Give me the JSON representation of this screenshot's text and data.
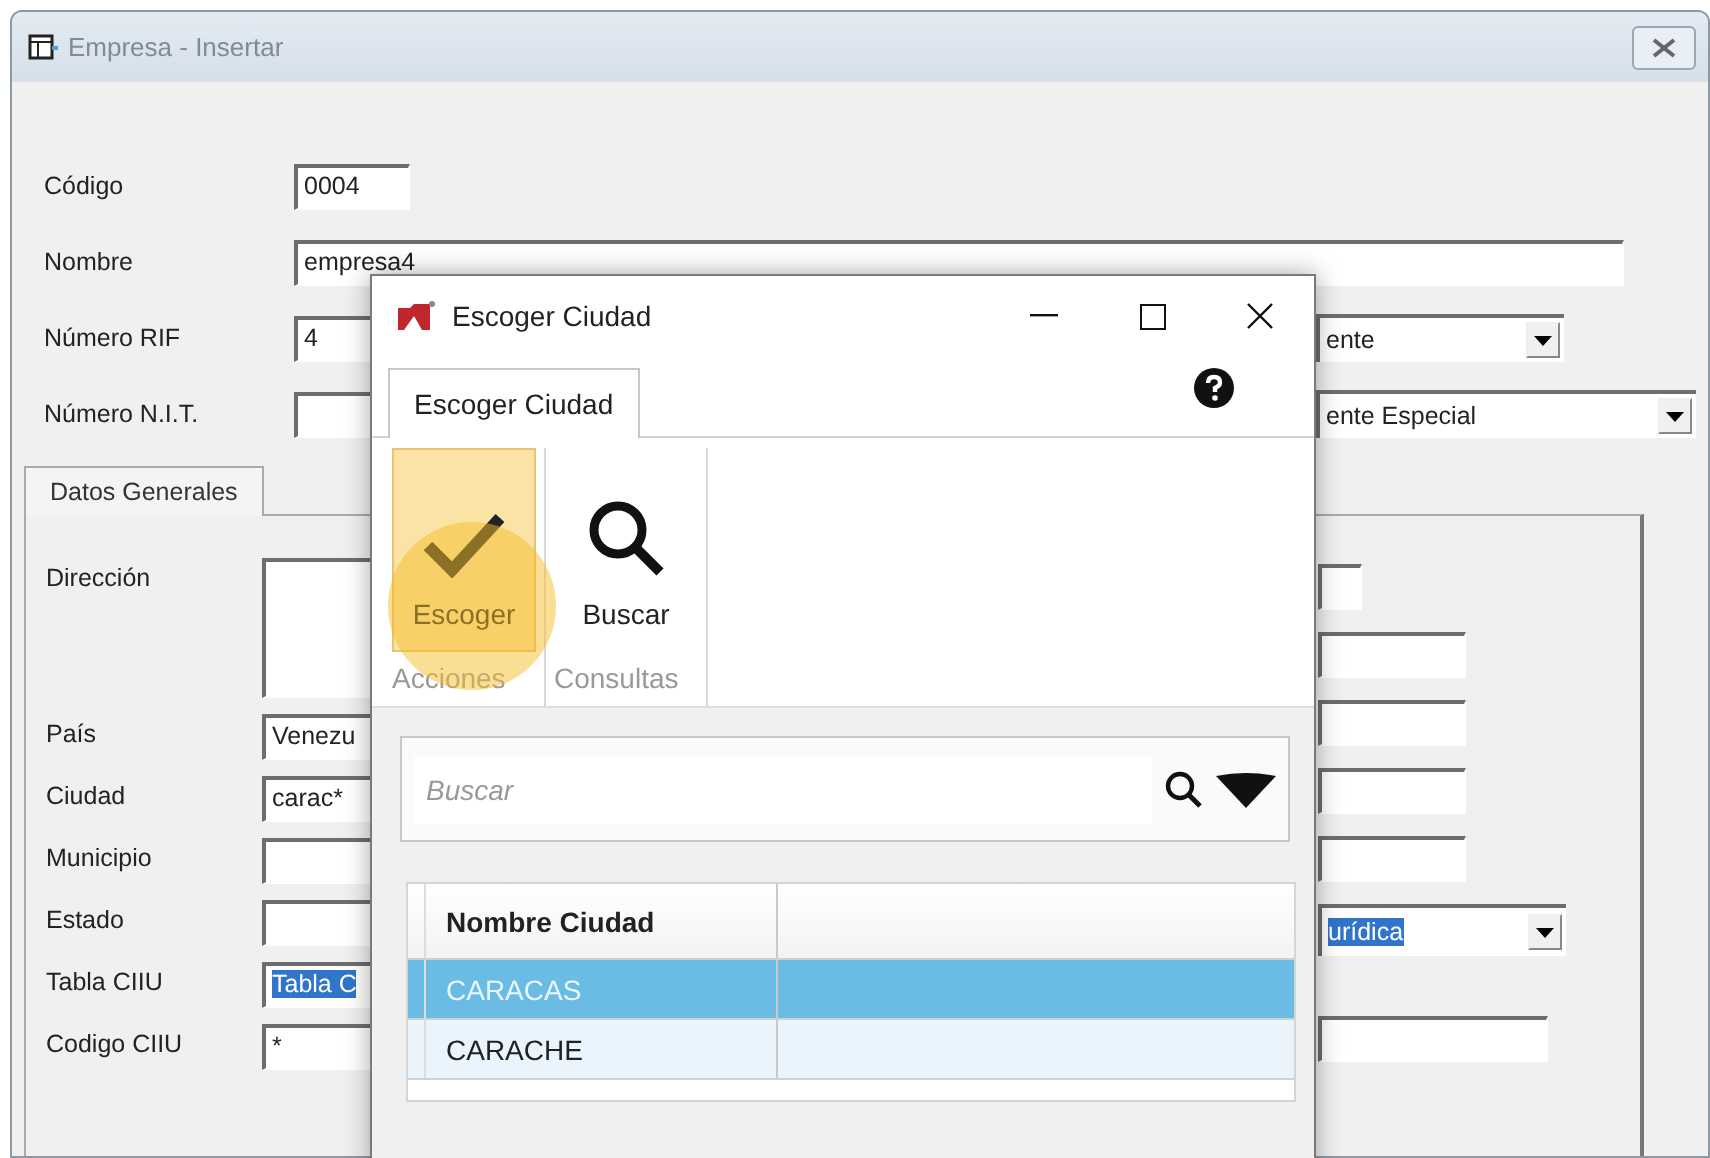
{
  "window": {
    "title": "Empresa - Insertar"
  },
  "header_fields": [
    {
      "label": "Código",
      "kind": "short",
      "value": "0004"
    },
    {
      "label": "Nombre",
      "kind": "long",
      "value": "empresa4"
    },
    {
      "label": "Número RIF",
      "kind": "combo",
      "value": "4",
      "combo": "ente"
    },
    {
      "label": "Número N.I.T.",
      "kind": "wide_combo",
      "combo": "ente Especial"
    }
  ],
  "tabs": [
    {
      "label": "Datos Generales",
      "selected": true
    }
  ],
  "general_fields": [
    {
      "label": "Dirección",
      "kind": "textarea"
    },
    {
      "label": "País",
      "kind": "field",
      "value": "Venezu"
    },
    {
      "label": "Ciudad",
      "kind": "field",
      "value": "carac*"
    },
    {
      "label": "Municipio",
      "kind": "field"
    },
    {
      "label": "Estado",
      "kind": "field"
    },
    {
      "label": "Tabla CIIU",
      "kind": "field",
      "value": "Tabla C",
      "highlighted": true
    },
    {
      "label": "Codigo CIIU",
      "kind": "field",
      "value": "*"
    }
  ],
  "right_fields": [
    {
      "kind": "small"
    },
    {
      "kind": "field"
    },
    {
      "kind": "field"
    },
    {
      "kind": "field"
    },
    {
      "kind": "field"
    },
    {
      "kind": "combo",
      "value": "urídica",
      "highlighted": true
    },
    {
      "kind": "wide"
    }
  ],
  "dialog": {
    "title": "Escoger Ciudad",
    "tabs": [
      {
        "label": "Escoger Ciudad",
        "selected": true
      }
    ],
    "groups": [
      {
        "label": "Acciones",
        "buttons": [
          {
            "label": "Escoger",
            "kind": "check",
            "hovered": true
          }
        ]
      },
      {
        "label": "Consultas",
        "buttons": [
          {
            "label": "Buscar",
            "kind": "search",
            "hovered": false
          }
        ]
      }
    ],
    "search": {
      "placeholder": "Buscar"
    },
    "table": {
      "columns": [
        "Nombre Ciudad"
      ],
      "rows": [
        {
          "cells": [
            "CARACAS"
          ],
          "selected": true
        },
        {
          "cells": [
            "CARACHE"
          ],
          "selected": false
        }
      ]
    }
  }
}
